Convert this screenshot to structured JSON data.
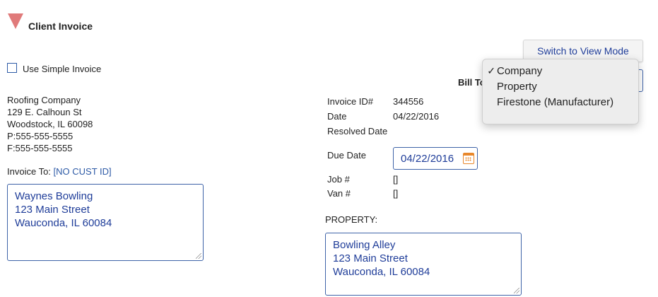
{
  "section": {
    "title": "Client Invoice"
  },
  "toolbar": {
    "switch_mode_label": "Switch to View Mode"
  },
  "options": {
    "simple_invoice_label": "Use Simple Invoice",
    "simple_invoice_checked": false
  },
  "company": {
    "lines": [
      "Roofing Company",
      "129 E. Calhoun St",
      "Woodstock, IL 60098",
      "P:555-555-5555",
      "F:555-555-5555"
    ]
  },
  "invoice_to": {
    "label": "Invoice To:",
    "customer_id": "[NO CUST ID]"
  },
  "client_address": {
    "lines": [
      "Waynes Bowling",
      "123 Main Street",
      "Wauconda, IL 60084"
    ]
  },
  "invoice": {
    "id_label": "Invoice ID#",
    "id_value": "344556",
    "date_label": "Date",
    "date_value": "04/22/2016",
    "resolved_label": "Resolved Date",
    "resolved_value": "",
    "due_label": "Due Date",
    "due_value": "04/22/2016",
    "job_label": "Job #",
    "job_value": "[]",
    "van_label": "Van #",
    "van_value": "[]"
  },
  "property": {
    "label": "PROPERTY:",
    "lines": [
      "Bowling Alley",
      "123 Main Street",
      "Wauconda, IL 60084"
    ]
  },
  "bill_to": {
    "label": "Bill To",
    "selected": "Company",
    "options": [
      {
        "label": "Company",
        "checked": true
      },
      {
        "label": "Property",
        "checked": false
      },
      {
        "label": "Firestone (Manufacturer)",
        "checked": false
      }
    ]
  },
  "colors": {
    "accent": "#2d5aa6",
    "input_text": "#1f3d99",
    "calendar": "#e8872b",
    "collapse_arrow": "#e07a7a"
  }
}
